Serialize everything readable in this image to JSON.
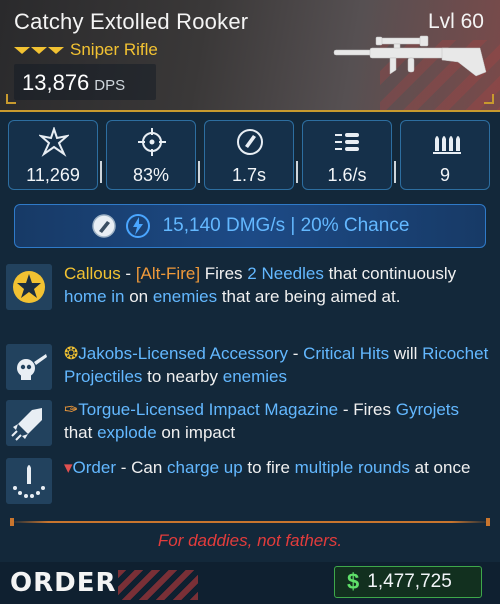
{
  "item": {
    "name": "Catchy Extolled Rooker",
    "level": "Lvl 60",
    "type": "Sniper Rifle",
    "dps_value": "13,876",
    "dps_unit": "DPS",
    "rarity_color": "#f2c232"
  },
  "stats": [
    {
      "icon": "damage-icon",
      "value": "11,269"
    },
    {
      "icon": "accuracy-icon",
      "value": "83%"
    },
    {
      "icon": "reload-icon",
      "value": "1.7s"
    },
    {
      "icon": "fire-rate-icon",
      "value": "1.6/s"
    },
    {
      "icon": "magazine-icon",
      "value": "9"
    }
  ],
  "elemental": {
    "text": "15,140 DMG/s | 20% Chance",
    "color": "#63b8ff"
  },
  "perks": [
    {
      "icon": "star-icon",
      "name": "Callous",
      "dash": " - ",
      "alt_fire": "[Alt-Fire]",
      "t1": " Fires ",
      "h1": "2 Needles",
      "t2": " that continuously ",
      "h2": "home in",
      "t3": " on ",
      "h3": "enemies",
      "t4": " that are being aimed at."
    },
    {
      "icon": "skull-icon",
      "name": "Jakobs-Licensed Accessory",
      "dash": " - ",
      "h1": "Critical Hits",
      "t1": " will ",
      "h2": "Ricochet Projectiles",
      "t2": " to nearby ",
      "h3": "enemies"
    },
    {
      "icon": "rocket-icon",
      "name": "Torgue-Licensed Impact Magazine",
      "dash": " - Fires ",
      "h1": "Gyrojets",
      "t1": " that ",
      "h2": "explode",
      "t2": " on impact"
    },
    {
      "icon": "bullet-icon",
      "name": "Order",
      "dash": " - Can ",
      "h1": "charge up",
      "t1": " to fire ",
      "h2": "multiple rounds",
      "t2": " at once"
    }
  ],
  "flavor_text": "For daddies, not fathers.",
  "manufacturer": "ORDER",
  "price": {
    "currency": "$",
    "amount": "1,477,725"
  }
}
